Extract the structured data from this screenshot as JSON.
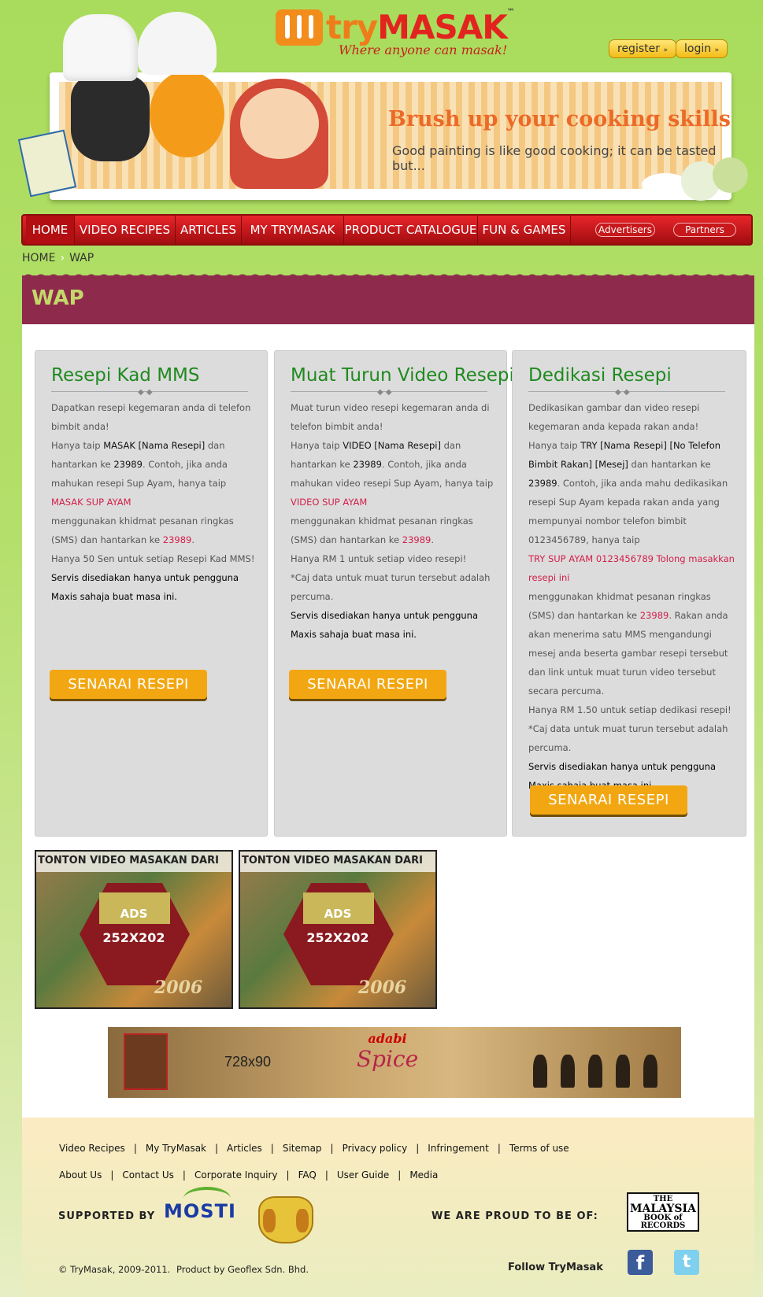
{
  "header": {
    "logo_try": "try",
    "logo_masak": "MASAK",
    "logo_tm": "™",
    "tagline": "Where anyone can masak!",
    "register_label": "register",
    "login_label": "login",
    "banner_title": "Brush up your cooking skills",
    "banner_subtitle": "Good painting is like good cooking; it can be tasted but..."
  },
  "nav": {
    "items": [
      "HOME",
      "VIDEO RECIPES",
      "ARTICLES",
      "MY TRYMASAK",
      "PRODUCT CATALOGUE",
      "FUN & GAMES"
    ],
    "pills": [
      "Advertisers",
      "Partners"
    ]
  },
  "breadcrumb": [
    "HOME",
    "WAP"
  ],
  "page_title": "WAP",
  "columns": [
    {
      "title": "Resepi Kad MMS",
      "p1": "Dapatkan resepi kegemaran anda di telefon bimbit anda!",
      "p2a": "Hanya taip ",
      "p2b": "MASAK [Nama Resepi]",
      "p2c": " dan hantarkan ke ",
      "p2d": "23989",
      "p2e": ". Contoh, jika anda mahukan resepi Sup Ayam, hanya taip",
      "p3": "MASAK SUP AYAM",
      "p4a": "menggunakan khidmat pesanan ringkas (SMS) dan hantarkan ke ",
      "p4b": "23989",
      "p4c": ".",
      "p5": "Hanya 50 Sen untuk setiap Resepi Kad MMS!",
      "p6": "Servis disediakan hanya untuk pengguna Maxis sahaja buat masa ini.",
      "button": "SENARAI RESEPI"
    },
    {
      "title": "Muat Turun Video Resepi",
      "p1": "Muat turun video resepi kegemaran anda di telefon bimbit anda!",
      "p2a": "Hanya taip ",
      "p2b": "VIDEO [Nama Resepi]",
      "p2c": " dan hantarkan ke ",
      "p2d": "23989",
      "p2e": ". Contoh, jika anda mahukan video resepi Sup Ayam, hanya taip",
      "p3": "VIDEO SUP AYAM",
      "p4a": "menggunakan khidmat pesanan ringkas (SMS) dan hantarkan ke ",
      "p4b": "23989",
      "p4c": ".",
      "p5": "Hanya RM 1 untuk setiap video resepi!",
      "p6": "*Caj data untuk muat turun tersebut adalah percuma.",
      "p7": "Servis disediakan hanya untuk pengguna Maxis sahaja buat masa ini.",
      "button": "SENARAI RESEPI"
    },
    {
      "title": "Dedikasi Resepi",
      "p1": "Dedikasikan gambar dan video resepi kegemaran anda kepada rakan anda!",
      "p2a": "Hanya taip ",
      "p2b": "TRY [Nama Resepi] [No Telefon Bimbit Rakan] [Mesej]",
      "p2c": " dan hantarkan ke ",
      "p2d": "23989",
      "p2e": ". Contoh, jika anda mahu dedikasikan resepi Sup Ayam kepada rakan anda yang mempunyai nombor telefon bimbit 0123456789, hanya taip",
      "p3": "TRY SUP AYAM 0123456789 Tolong masakkan resepi ini",
      "p4a": "menggunakan khidmat pesanan ringkas (SMS) dan hantarkan ke ",
      "p4b": "23989",
      "p4c": ". Rakan anda akan menerima satu MMS mengandungi mesej anda beserta gambar resepi tersebut dan link untuk muat turun video tersebut secara percuma.",
      "p5": "Hanya RM 1.50 untuk setiap dedikasi resepi!",
      "p6": "*Caj data untuk muat turun tersebut adalah percuma.",
      "p7": "Servis disediakan hanya untuk pengguna Maxis sahaja buat masa ini.",
      "button": "SENARAI RESEPI"
    }
  ],
  "ads": [
    {
      "header": "TONTON VIDEO MASAKAN DARI",
      "label": "ADS",
      "size": "252X202",
      "year": "2006"
    },
    {
      "header": "TONTON VIDEO MASAKAN DARI",
      "label": "ADS",
      "size": "252X202",
      "year": "2006"
    }
  ],
  "leaderboard": {
    "size": "728x90",
    "brand": "adabi",
    "product": "Spice"
  },
  "footer": {
    "links_row1": [
      "Video Recipes",
      "My TryMasak",
      "Articles",
      "Sitemap",
      "Privacy policy",
      "Infringement",
      "Terms of use"
    ],
    "links_row2": [
      "About Us",
      "Contact Us",
      "Corporate Inquiry",
      "FAQ",
      "User Guide",
      "Media"
    ],
    "supported_by": "SUPPORTED BY",
    "mosti": "MOSTI",
    "proud": "WE ARE PROUD TO BE OF:",
    "mbr_1": "THE",
    "mbr_2": "MALAYSIA",
    "mbr_3": "BOOK of RECORDS",
    "copyright": "© TryMasak, 2009-2011.",
    "product_by": "Product by Geoflex Sdn. Bhd.",
    "follow": "Follow TryMasak",
    "fb": "f",
    "tw": "t"
  },
  "colors": {
    "brand_orange": "#ef7c1a",
    "brand_red": "#e2241f",
    "nav_red": "#c7181b",
    "wap_bar": "#8e2b4c",
    "title_green": "#1f8a1f",
    "button_orange": "#f2a712",
    "sms_red": "#d12048"
  }
}
